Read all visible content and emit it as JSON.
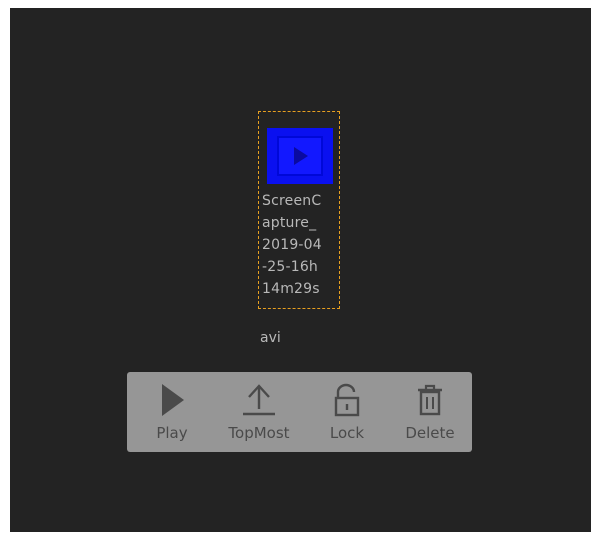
{
  "file": {
    "name_lines": [
      "ScreenC",
      "apture_",
      "2019-04",
      "-25-16h",
      "14m29s"
    ],
    "name_tail": "avi",
    "thumbnail_icon": "play-icon",
    "thumbnail_color": "#0a10f0",
    "selection_color": "#e8a020"
  },
  "toolbar": {
    "items": [
      {
        "label": "Play",
        "icon": "play-icon"
      },
      {
        "label": "TopMost",
        "icon": "upload-icon"
      },
      {
        "label": "Lock",
        "icon": "unlock-icon"
      },
      {
        "label": "Delete",
        "icon": "trash-icon"
      }
    ]
  },
  "colors": {
    "background": "#232323",
    "toolbar": "#969696",
    "icon": "#4a4a4a"
  }
}
